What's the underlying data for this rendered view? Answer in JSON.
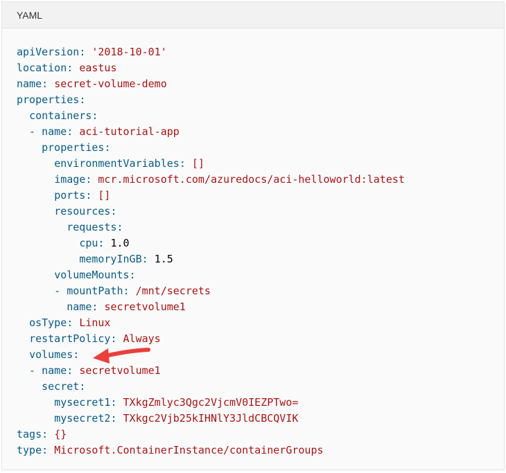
{
  "code_block": {
    "language_label": "YAML",
    "lines": [
      {
        "indent": "",
        "key": "apiVersion",
        "sep": ": ",
        "value": "'2018-10-01'",
        "value_style": "v"
      },
      {
        "indent": "",
        "key": "location",
        "sep": ": ",
        "value": "eastus",
        "value_style": "v"
      },
      {
        "indent": "",
        "key": "name",
        "sep": ": ",
        "value": "secret-volume-demo",
        "value_style": "v"
      },
      {
        "indent": "",
        "key": "properties",
        "sep": ":",
        "value": "",
        "value_style": "v"
      },
      {
        "indent": "  ",
        "key": "containers",
        "sep": ":",
        "value": "",
        "value_style": "v"
      },
      {
        "indent": "  - ",
        "key": "name",
        "sep": ": ",
        "value": "aci-tutorial-app",
        "value_style": "v"
      },
      {
        "indent": "    ",
        "key": "properties",
        "sep": ":",
        "value": "",
        "value_style": "v"
      },
      {
        "indent": "      ",
        "key": "environmentVariables",
        "sep": ": ",
        "value": "[]",
        "value_style": "v"
      },
      {
        "indent": "      ",
        "key": "image",
        "sep": ": ",
        "value": "mcr.microsoft.com/azuredocs/aci-helloworld:latest",
        "value_style": "v"
      },
      {
        "indent": "      ",
        "key": "ports",
        "sep": ": ",
        "value": "[]",
        "value_style": "v"
      },
      {
        "indent": "      ",
        "key": "resources",
        "sep": ":",
        "value": "",
        "value_style": "v"
      },
      {
        "indent": "        ",
        "key": "requests",
        "sep": ":",
        "value": "",
        "value_style": "v"
      },
      {
        "indent": "          ",
        "key": "cpu",
        "sep": ": ",
        "value": "1.0",
        "value_style": "n"
      },
      {
        "indent": "          ",
        "key": "memoryInGB",
        "sep": ": ",
        "value": "1.5",
        "value_style": "n"
      },
      {
        "indent": "      ",
        "key": "volumeMounts",
        "sep": ":",
        "value": "",
        "value_style": "v"
      },
      {
        "indent": "      - ",
        "key": "mountPath",
        "sep": ": ",
        "value": "/mnt/secrets",
        "value_style": "v"
      },
      {
        "indent": "        ",
        "key": "name",
        "sep": ": ",
        "value": "secretvolume1",
        "value_style": "v"
      },
      {
        "indent": "  ",
        "key": "osType",
        "sep": ": ",
        "value": "Linux",
        "value_style": "v"
      },
      {
        "indent": "  ",
        "key": "restartPolicy",
        "sep": ": ",
        "value": "Always",
        "value_style": "v"
      },
      {
        "indent": "  ",
        "key": "volumes",
        "sep": ":",
        "value": "",
        "value_style": "v"
      },
      {
        "indent": "  - ",
        "key": "name",
        "sep": ": ",
        "value": "secretvolume1",
        "value_style": "v"
      },
      {
        "indent": "    ",
        "key": "secret",
        "sep": ":",
        "value": "",
        "value_style": "v"
      },
      {
        "indent": "      ",
        "key": "mysecret1",
        "sep": ": ",
        "value": "TXkgZmlyc3Qgc2VjcmV0IEZPTwo=",
        "value_style": "v"
      },
      {
        "indent": "      ",
        "key": "mysecret2",
        "sep": ": ",
        "value": "TXkgc2Vjb25kIHNlY3JldCBCQVIK",
        "value_style": "v"
      },
      {
        "indent": "",
        "key": "tags",
        "sep": ": ",
        "value": "{}",
        "value_style": "v"
      },
      {
        "indent": "",
        "key": "type",
        "sep": ": ",
        "value": "Microsoft.ContainerInstance/containerGroups",
        "value_style": "v"
      }
    ]
  },
  "annotation": {
    "icon": "red-arrow-icon",
    "color": "#e8403c"
  },
  "colors": {
    "key": "#0a5a82",
    "string_value": "#a31515",
    "numeric_value": "#000000"
  }
}
